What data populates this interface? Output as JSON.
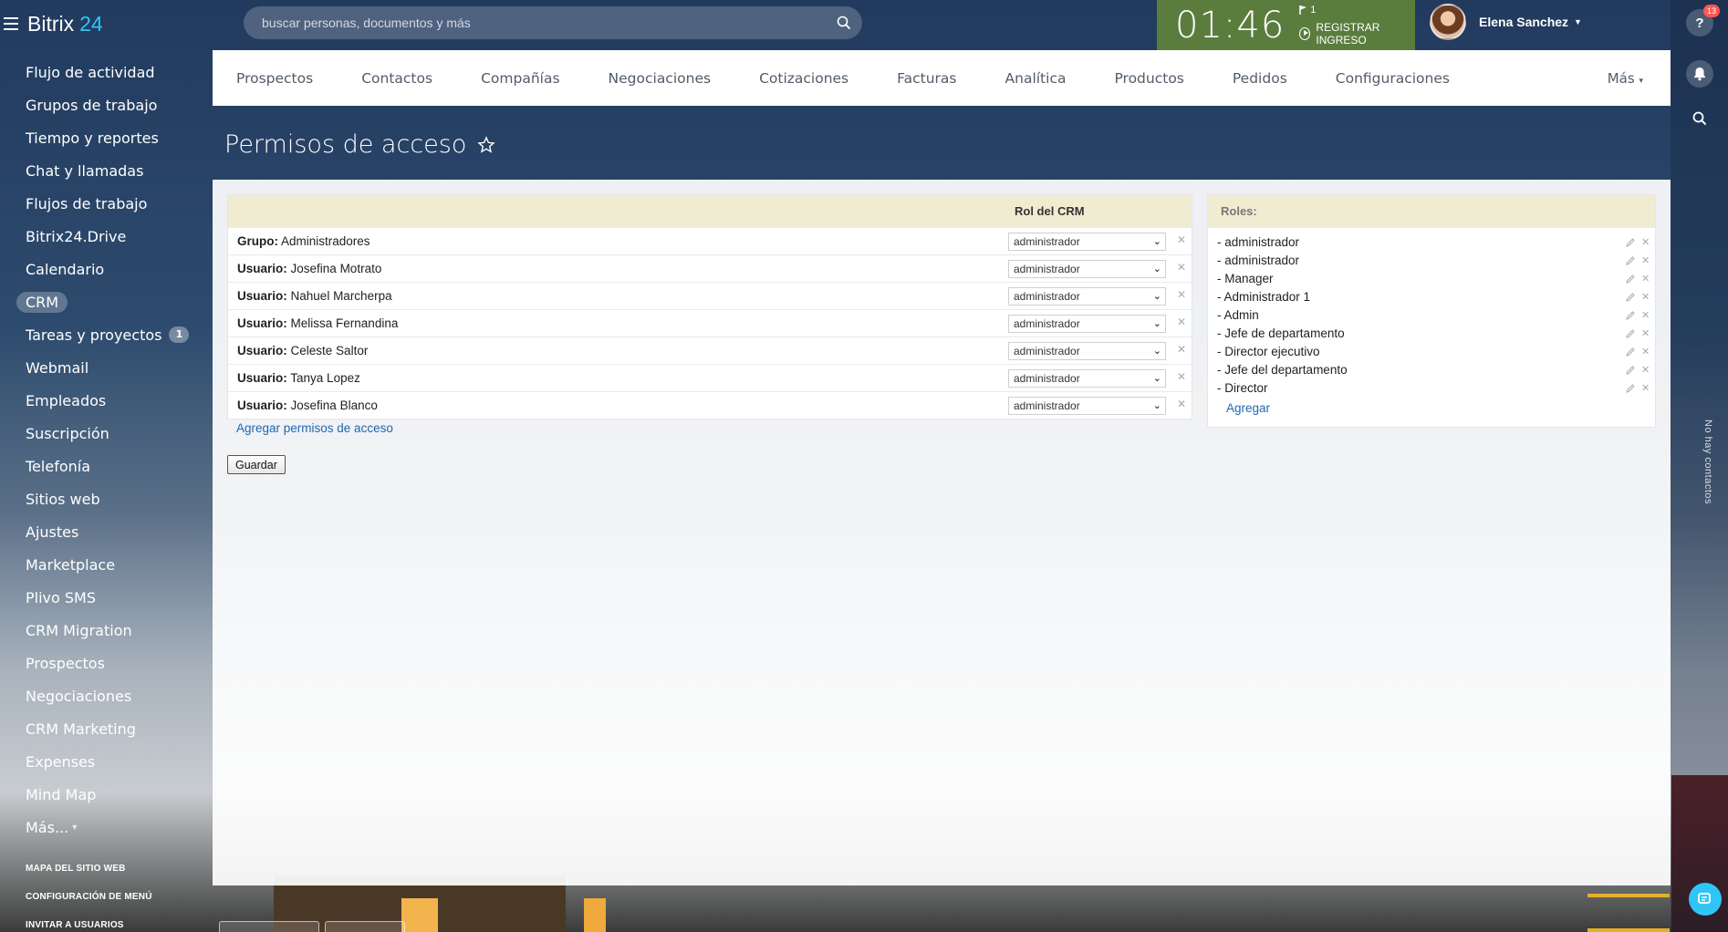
{
  "logo": {
    "brand": "Bitrix",
    "number": "24"
  },
  "sidebar": {
    "items": [
      {
        "label": "Flujo de actividad"
      },
      {
        "label": "Grupos de trabajo"
      },
      {
        "label": "Tiempo y reportes"
      },
      {
        "label": "Chat y llamadas"
      },
      {
        "label": "Flujos de trabajo"
      },
      {
        "label": "Bitrix24.Drive"
      },
      {
        "label": "Calendario"
      },
      {
        "label": "CRM",
        "active": true
      },
      {
        "label": "Tareas y proyectos",
        "counter": "1"
      },
      {
        "label": "Webmail"
      },
      {
        "label": "Empleados"
      },
      {
        "label": "Suscripción"
      },
      {
        "label": "Telefonía"
      },
      {
        "label": "Sitios web"
      },
      {
        "label": "Ajustes"
      },
      {
        "label": "Marketplace"
      },
      {
        "label": "Plivo SMS"
      },
      {
        "label": "CRM Migration"
      },
      {
        "label": "Prospectos"
      },
      {
        "label": "Negociaciones"
      },
      {
        "label": "CRM Marketing"
      },
      {
        "label": "Expenses"
      },
      {
        "label": "Mind Map"
      }
    ],
    "more_label": "Más...",
    "footer": {
      "sitemap": "MAPA DEL SITIO WEB",
      "menu_config": "CONFIGURACIÓN DE MENÚ",
      "invite": "INVITAR A USUARIOS"
    }
  },
  "search": {
    "placeholder": "buscar personas, documentos y más"
  },
  "clock": {
    "time": "01:46",
    "flag_count": "1",
    "register_label": "REGISTRAR INGRESO",
    "bg_color": "#5a7d3e"
  },
  "user": {
    "name": "Elena Sanchez"
  },
  "right_rail": {
    "help_badge": "13",
    "vertical_text": "No hay contactos"
  },
  "topnav": {
    "items": [
      "Prospectos",
      "Contactos",
      "Compañías",
      "Negociaciones",
      "Cotizaciones",
      "Facturas",
      "Analítica",
      "Productos",
      "Pedidos",
      "Configuraciones"
    ],
    "more_label": "Más"
  },
  "page": {
    "title": "Permisos de acceso"
  },
  "permissions": {
    "column_header": "Rol del CRM",
    "rows": [
      {
        "type": "Grupo:",
        "name": "Administradores",
        "role": "administrador"
      },
      {
        "type": "Usuario:",
        "name": "Josefina Motrato",
        "role": "administrador"
      },
      {
        "type": "Usuario:",
        "name": "Nahuel Marcherpa",
        "role": "administrador"
      },
      {
        "type": "Usuario:",
        "name": "Melissa Fernandina",
        "role": "administrador"
      },
      {
        "type": "Usuario:",
        "name": "Celeste Saltor",
        "role": "administrador"
      },
      {
        "type": "Usuario:",
        "name": "Tanya Lopez",
        "role": "administrador"
      },
      {
        "type": "Usuario:",
        "name": "Josefina Blanco",
        "role": "administrador"
      }
    ],
    "add_link": "Agregar permisos de acceso",
    "save_label": "Guardar"
  },
  "roles": {
    "header": "Roles:",
    "items": [
      "- administrador",
      "- administrador",
      "- Manager",
      "- Administrador 1",
      "- Admin",
      "- Jefe de departamento",
      "- Director ejecutivo",
      "- Jefe del departamento",
      "- Director"
    ],
    "add_label": "Agregar"
  },
  "colors": {
    "accent_blue": "#2fc6f6",
    "link_blue": "#2067b0",
    "table_header_bg": "#f0ecd2"
  }
}
